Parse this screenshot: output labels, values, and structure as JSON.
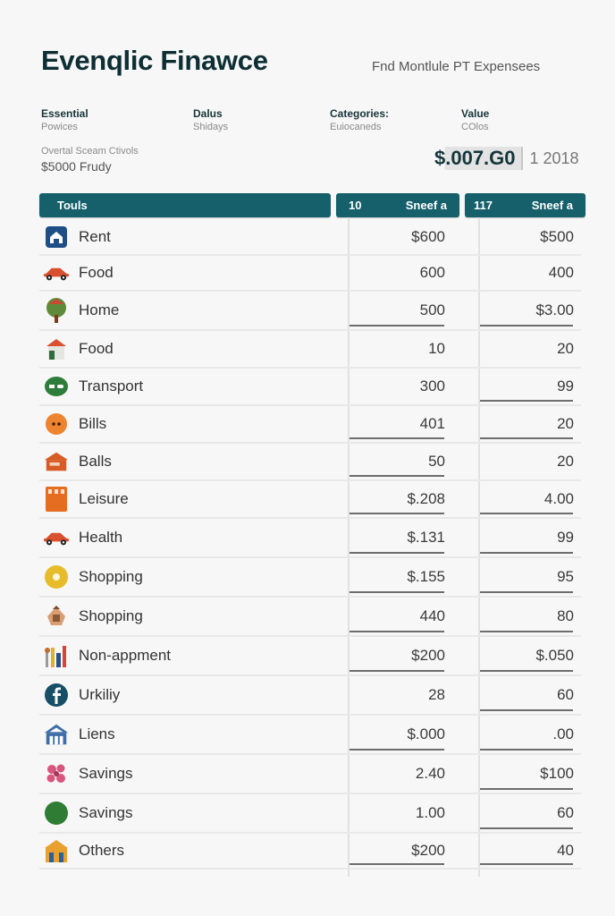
{
  "header": {
    "title": "Evenqlic Finawce",
    "subtitle": "Fnd Montlule PT Expensees"
  },
  "meta": [
    {
      "label": "Essential",
      "sub": "Powices"
    },
    {
      "label": "Dalus",
      "sub": "Shidays"
    },
    {
      "label": "Categories:",
      "sub": "Euiocaneds"
    },
    {
      "label": "Value",
      "sub": "COlos"
    }
  ],
  "overall": {
    "label": "Overtal Sceam Ctivols",
    "value": "$5000 Frudy"
  },
  "total": {
    "value": "$.007.G0",
    "year": "1 2018"
  },
  "table": {
    "header_main": "Touls",
    "col1": {
      "num": "10",
      "label": "Sneef a"
    },
    "col2": {
      "num": "117",
      "label": "Sneef a"
    },
    "rows": [
      {
        "icon": "house-icon",
        "name": "Rent",
        "v1": "$600",
        "v2": "$500",
        "u1": false,
        "u2": false
      },
      {
        "icon": "car-icon",
        "name": "Food",
        "v1": "600",
        "v2": "400",
        "u1": false,
        "u2": false
      },
      {
        "icon": "tree-icon",
        "name": "Home",
        "v1": "500",
        "v2": "$3.00",
        "u1": true,
        "u2": true
      },
      {
        "icon": "home-icon",
        "name": "Food",
        "v1": "10",
        "v2": "20",
        "u1": false,
        "u2": false
      },
      {
        "icon": "transport-icon",
        "name": "Transport",
        "v1": "300",
        "v2": "99",
        "u1": false,
        "u2": true
      },
      {
        "icon": "bills-icon",
        "name": "Bills",
        "v1": "401",
        "v2": "20",
        "u1": true,
        "u2": true
      },
      {
        "icon": "shop-icon",
        "name": "Balls",
        "v1": "50",
        "v2": "20",
        "u1": true,
        "u2": false
      },
      {
        "icon": "leisure-icon",
        "name": "Leisure",
        "v1": "$.208",
        "v2": "4.00",
        "u1": true,
        "u2": true
      },
      {
        "icon": "car-icon",
        "name": "Health",
        "v1": "$.131",
        "v2": "99",
        "u1": true,
        "u2": true
      },
      {
        "icon": "coin-icon",
        "name": "Shopping",
        "v1": "$.155",
        "v2": "95",
        "u1": true,
        "u2": true
      },
      {
        "icon": "bag-icon",
        "name": "Shopping",
        "v1": "440",
        "v2": "80",
        "u1": true,
        "u2": true
      },
      {
        "icon": "tools-icon",
        "name": "Non-appment",
        "v1": "$200",
        "v2": "$.050",
        "u1": true,
        "u2": true
      },
      {
        "icon": "facebook-icon",
        "name": "Urkiliy",
        "v1": "28",
        "v2": "60",
        "u1": false,
        "u2": true
      },
      {
        "icon": "bank-icon",
        "name": "Liens",
        "v1": "$.000",
        "v2": ".00",
        "u1": true,
        "u2": true
      },
      {
        "icon": "flower-icon",
        "name": "Savings",
        "v1": "2.40",
        "v2": "$100",
        "u1": false,
        "u2": true
      },
      {
        "icon": "moon-icon",
        "name": "Savings",
        "v1": "1.00",
        "v2": "60",
        "u1": false,
        "u2": true
      },
      {
        "icon": "building-icon",
        "name": "Others",
        "v1": "$200",
        "v2": "40",
        "u1": true,
        "u2": true
      }
    ]
  },
  "colors": {
    "accent": "#15606b",
    "title": "#0d2e33",
    "background": "#f7f7f7"
  }
}
